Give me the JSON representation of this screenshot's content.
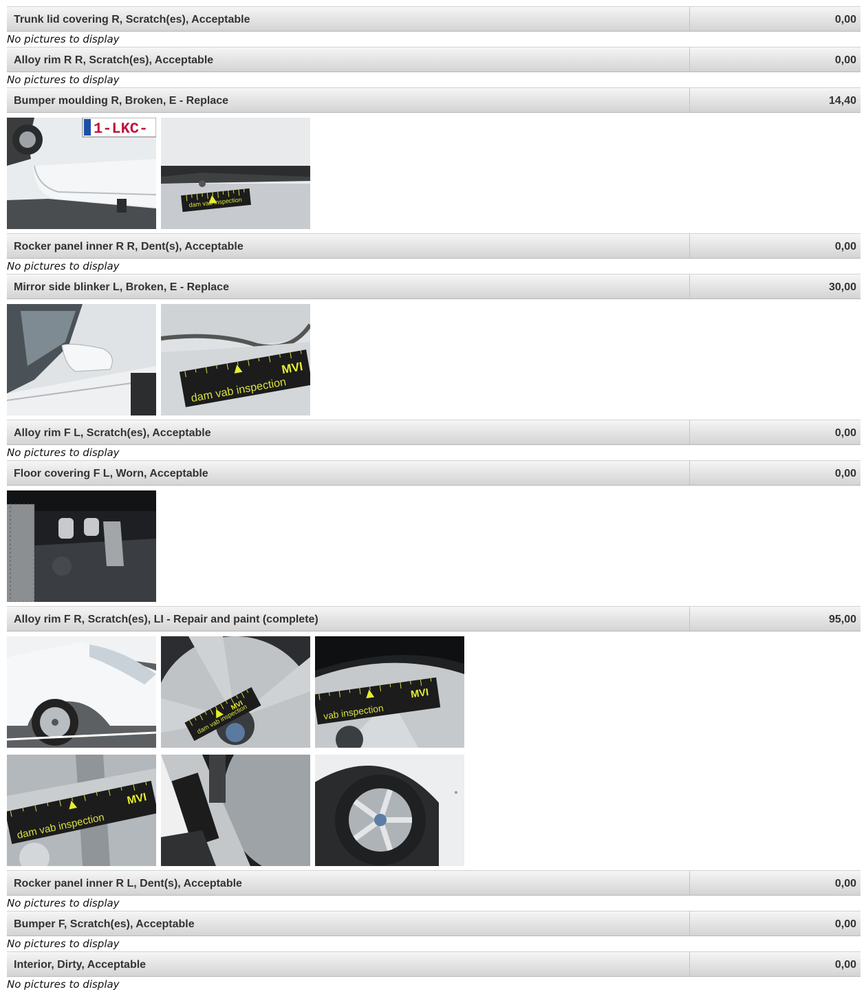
{
  "damage_items": [
    {
      "title": "Trunk lid covering R, Scratch(es), Acceptable",
      "cost": "0,00",
      "no_pictures_text": "No pictures to display",
      "photos": []
    },
    {
      "title": "Alloy rim R R, Scratch(es), Acceptable",
      "cost": "0,00",
      "no_pictures_text": "No pictures to display",
      "photos": []
    },
    {
      "title": "Bumper moulding R, Broken, E - Replace",
      "cost": "14,40",
      "photos": [
        {
          "icon": "rear-bumper-photo",
          "plate_text": "1-LKC-"
        },
        {
          "icon": "bumper-closeup-photo",
          "gauge_text": "dam vab inspection"
        }
      ]
    },
    {
      "title": "Rocker panel inner R R, Dent(s), Acceptable",
      "cost": "0,00",
      "no_pictures_text": "No pictures to display",
      "photos": []
    },
    {
      "title": "Mirror side blinker L, Broken, E - Replace",
      "cost": "30,00",
      "photos": [
        {
          "icon": "side-mirror-photo"
        },
        {
          "icon": "blinker-closeup-photo",
          "gauge_text": "dam vab inspection",
          "logo_text": "MVI"
        }
      ]
    },
    {
      "title": "Alloy rim F L, Scratch(es), Acceptable",
      "cost": "0,00",
      "no_pictures_text": "No pictures to display",
      "photos": []
    },
    {
      "title": "Floor covering F L, Worn, Acceptable",
      "cost": "0,00",
      "photos": [
        {
          "icon": "floor-covering-photo"
        }
      ]
    },
    {
      "title": "Alloy rim F R, Scratch(es), LI - Repair and paint (complete)",
      "cost": "95,00",
      "photos": [
        {
          "icon": "front-corner-photo"
        },
        {
          "icon": "rim-closeup-photo",
          "gauge_text": "dam vab inspection",
          "logo_text": "MVI"
        },
        {
          "icon": "rim-gauge-photo",
          "gauge_text": "vab inspection",
          "logo_text": "MVI"
        },
        {
          "icon": "rim-spoke-photo",
          "gauge_text": "dam vab inspection",
          "logo_text": "MVI"
        },
        {
          "icon": "tire-gauge-photo"
        },
        {
          "icon": "wheel-overview-photo"
        }
      ]
    },
    {
      "title": "Rocker panel inner R L, Dent(s), Acceptable",
      "cost": "0,00",
      "no_pictures_text": "No pictures to display",
      "photos": []
    },
    {
      "title": "Bumper F, Scratch(es), Acceptable",
      "cost": "0,00",
      "no_pictures_text": "No pictures to display",
      "photos": []
    },
    {
      "title": "Interior, Dirty, Acceptable",
      "cost": "0,00",
      "no_pictures_text": "No pictures to display",
      "photos": []
    }
  ]
}
